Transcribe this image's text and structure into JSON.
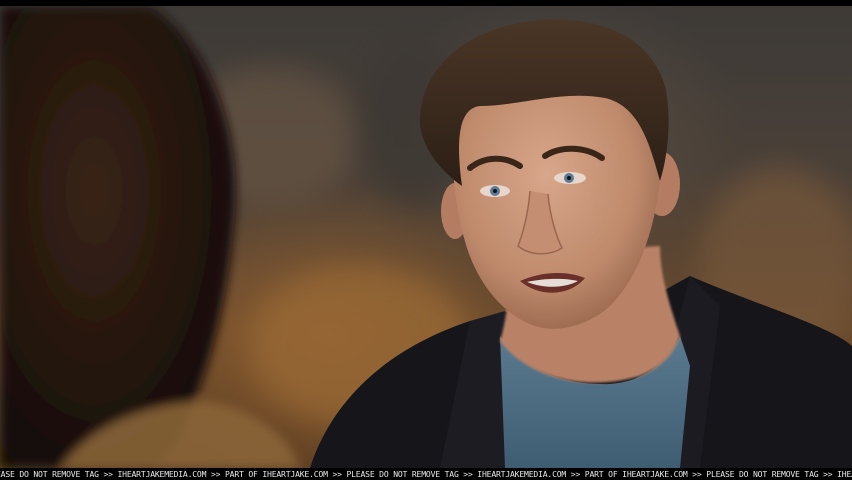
{
  "scene": {
    "subject": "person-in-dark-jacket",
    "foreground": "blurred-hair-silhouette",
    "colors": {
      "jacket": "#15151a",
      "shirt": "#4e6f85",
      "skin": "#c9957a",
      "hair": "#3a2a1e",
      "background": "#5a4330"
    }
  },
  "watermark": {
    "text": "EASE DO NOT REMOVE TAG >> IHEARTJAKEMEDIA.COM >> PART OF IHEARTJAKE.COM >> PLEASE DO NOT REMOVE TAG >> IHEARTJAKEMEDIA.COM >> PART OF IHEARTJAKE.COM >> PLEASE DO NOT REMOVE TAG >> IHEARTJAKEN"
  }
}
